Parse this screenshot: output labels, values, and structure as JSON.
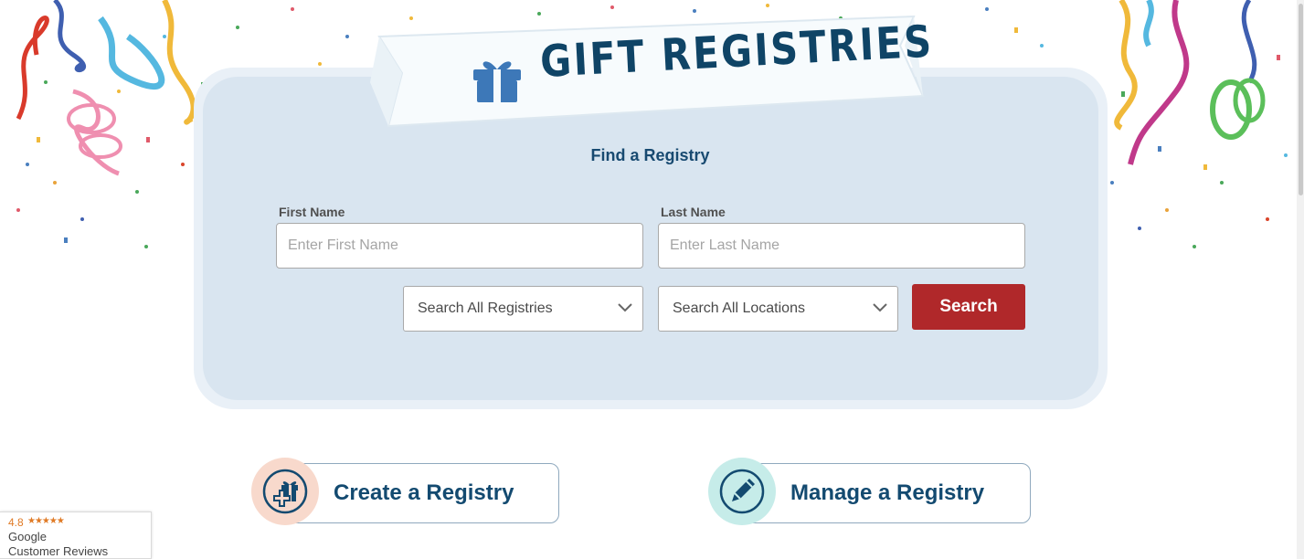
{
  "banner": {
    "title": "GIFT REGISTRIES",
    "icon": "gift-icon"
  },
  "find": {
    "title": "Find a Registry",
    "first_name_label": "First Name",
    "first_name_placeholder": "Enter First Name",
    "last_name_label": "Last Name",
    "last_name_placeholder": "Enter Last Name",
    "registry_select": "Search All Registries",
    "location_select": "Search All Locations",
    "search_button": "Search"
  },
  "actions": {
    "create": {
      "label": "Create a Registry",
      "icon": "gift-plus-icon"
    },
    "manage": {
      "label": "Manage a Registry",
      "icon": "pencil-icon"
    }
  },
  "reviews": {
    "rating": "4.8",
    "stars": "★★★★★",
    "brand": "Google",
    "caption": "Customer Reviews"
  },
  "colors": {
    "accent": "#b0282a",
    "title": "#0f4466",
    "panel": "#d9e5f0",
    "create_circle": "#f8d9cc",
    "manage_circle": "#c6ece9"
  }
}
